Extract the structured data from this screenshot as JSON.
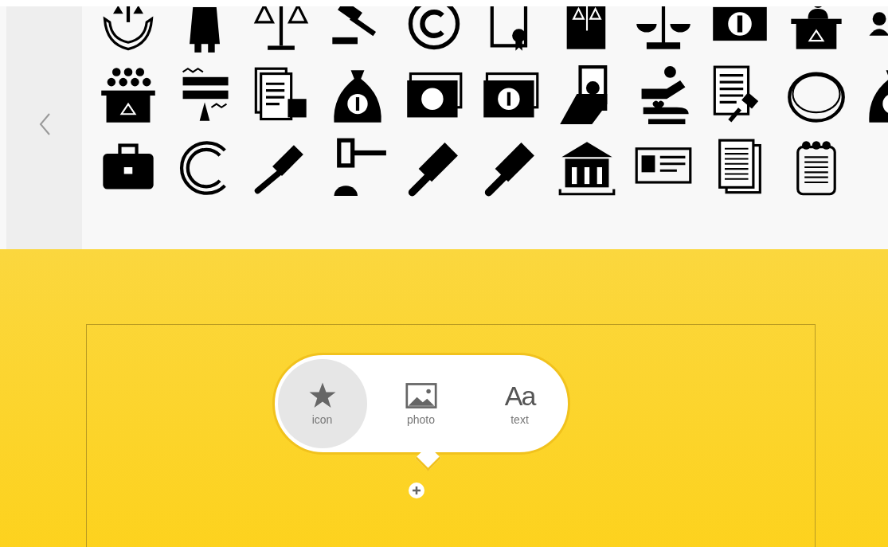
{
  "popup": {
    "options": [
      {
        "kind": "icon",
        "label": "icon",
        "selected": true
      },
      {
        "kind": "photo",
        "label": "photo",
        "selected": false
      },
      {
        "kind": "text",
        "glyph": "Aa",
        "label": "text",
        "selected": false
      }
    ]
  }
}
